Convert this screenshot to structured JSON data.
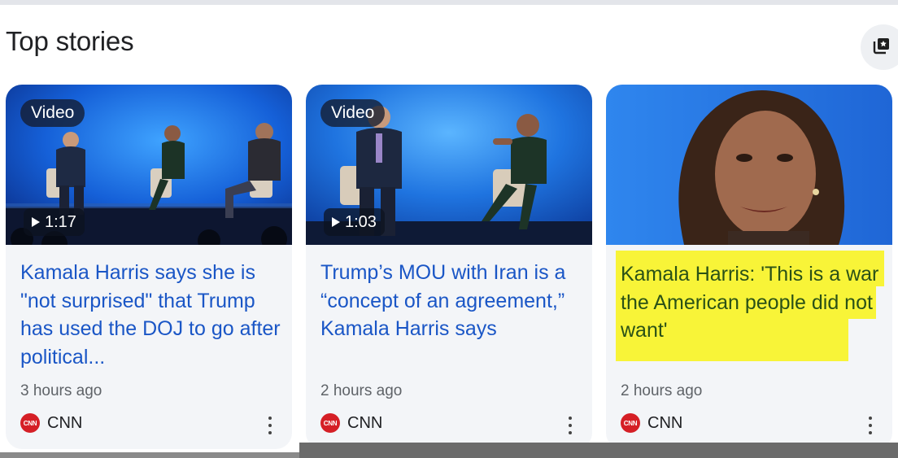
{
  "section": {
    "title": "Top stories"
  },
  "stories": [
    {
      "badge": "Video",
      "duration": "1:17",
      "headline": "Kamala Harris says she is \"not surprised\" that Trump has used the DOJ to go after political...",
      "time": "3 hours ago",
      "source": "CNN",
      "logo_text": "CNN"
    },
    {
      "badge": "Video",
      "duration": "1:03",
      "headline": "Trump’s MOU with Iran is a “concept of an agreement,” Kamala Harris says",
      "time": "2 hours ago",
      "source": "CNN",
      "logo_text": "CNN"
    },
    {
      "headline": "Kamala Harris: 'This is a war the American people did not want'",
      "time": "2 hours ago",
      "source": "CNN",
      "logo_text": "CNN"
    }
  ],
  "colors": {
    "headline_link": "#1a56c6",
    "highlight": "#f8f316",
    "cnn_red": "#d51f26"
  },
  "icons": {
    "save": "bookmark-star-icon",
    "play": "play-icon",
    "more": "more-vert-icon"
  }
}
